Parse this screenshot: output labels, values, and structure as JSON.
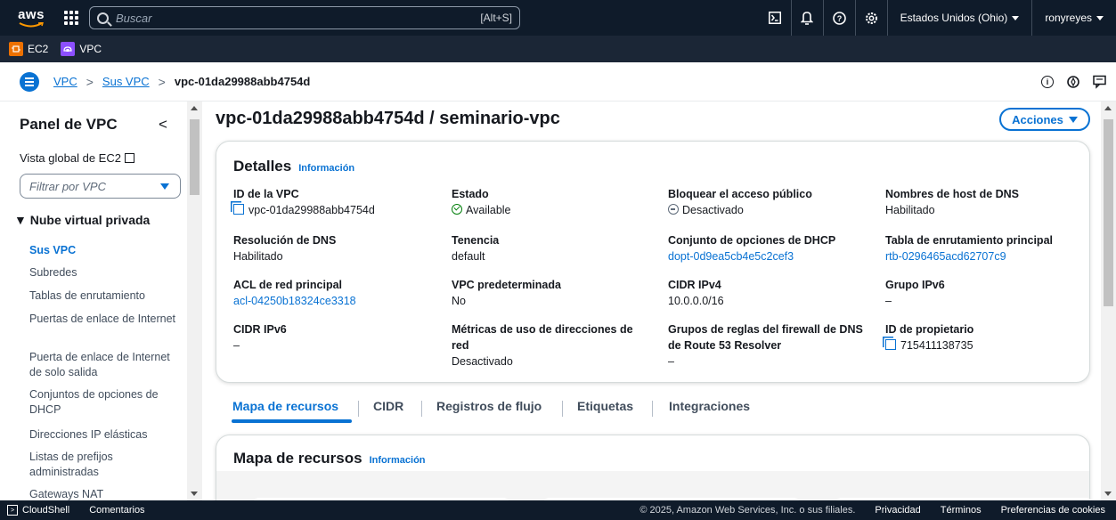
{
  "topnav": {
    "logo": "aws",
    "search_placeholder": "Buscar",
    "search_shortcut": "[Alt+S]",
    "region": "Estados Unidos (Ohio)",
    "user": "ronyreyes"
  },
  "favorites": [
    {
      "label": "EC2",
      "icon": "ec2-icon",
      "color": "#ed7100"
    },
    {
      "label": "VPC",
      "icon": "vpc-icon",
      "color": "#8c4fff"
    }
  ],
  "breadcrumb": {
    "items": [
      "VPC",
      "Sus VPC"
    ],
    "current": "vpc-01da29988abb4754d"
  },
  "sidebar": {
    "title": "Panel de VPC",
    "global_link": "Vista global de EC2",
    "filter_placeholder": "Filtrar por VPC",
    "section": "Nube virtual privada",
    "items": [
      "Sus VPC",
      "Subredes",
      "Tablas de enrutamiento",
      "Puertas de enlace de Internet",
      "Puerta de enlace de Internet de solo salida",
      "Conjuntos de opciones de DHCP",
      "Direcciones IP elásticas",
      "Listas de prefijos administradas",
      "Gateways NAT"
    ]
  },
  "main": {
    "title": "vpc-01da29988abb4754d / seminario-vpc",
    "actions_label": "Acciones",
    "details": {
      "title": "Detalles",
      "info": "Información",
      "fields": [
        {
          "label": "ID de la VPC",
          "value": "vpc-01da29988abb4754d"
        },
        {
          "label": "Estado",
          "value": "Available"
        },
        {
          "label": "Bloquear el acceso público",
          "value": "Desactivado"
        },
        {
          "label": "Nombres de host de DNS",
          "value": "Habilitado"
        },
        {
          "label": "Resolución de DNS",
          "value": "Habilitado"
        },
        {
          "label": "Tenencia",
          "value": "default"
        },
        {
          "label": "Conjunto de opciones de DHCP",
          "value": "dopt-0d9ea5cb4e5c2cef3"
        },
        {
          "label": "Tabla de enrutamiento principal",
          "value": "rtb-0296465acd62707c9"
        },
        {
          "label": "ACL de red principal",
          "value": "acl-04250b18324ce3318"
        },
        {
          "label": "VPC predeterminada",
          "value": "No"
        },
        {
          "label": "CIDR IPv4",
          "value": "10.0.0.0/16"
        },
        {
          "label": "Grupo IPv6",
          "value": "–"
        },
        {
          "label": "CIDR IPv6",
          "value": "–"
        },
        {
          "label": "Métricas de uso de direcciones de red",
          "value": "Desactivado"
        },
        {
          "label": "Grupos de reglas del firewall de DNS de Route 53 Resolver",
          "value": "–"
        },
        {
          "label": "ID de propietario",
          "value": "715411138735"
        }
      ]
    },
    "tabs": [
      "Mapa de recursos",
      "CIDR",
      "Registros de flujo",
      "Etiquetas",
      "Integraciones"
    ],
    "resource_map": {
      "title": "Mapa de recursos",
      "info": "Información"
    }
  },
  "footer": {
    "cloudshell": "CloudShell",
    "comments": "Comentarios",
    "copyright": "© 2025, Amazon Web Services, Inc. o sus filiales.",
    "privacy": "Privacidad",
    "terms": "Términos",
    "cookies": "Preferencias de cookies"
  },
  "colors": {
    "nav_bg": "#0f1b2a",
    "link": "#0972d3",
    "success": "#037f0c"
  }
}
